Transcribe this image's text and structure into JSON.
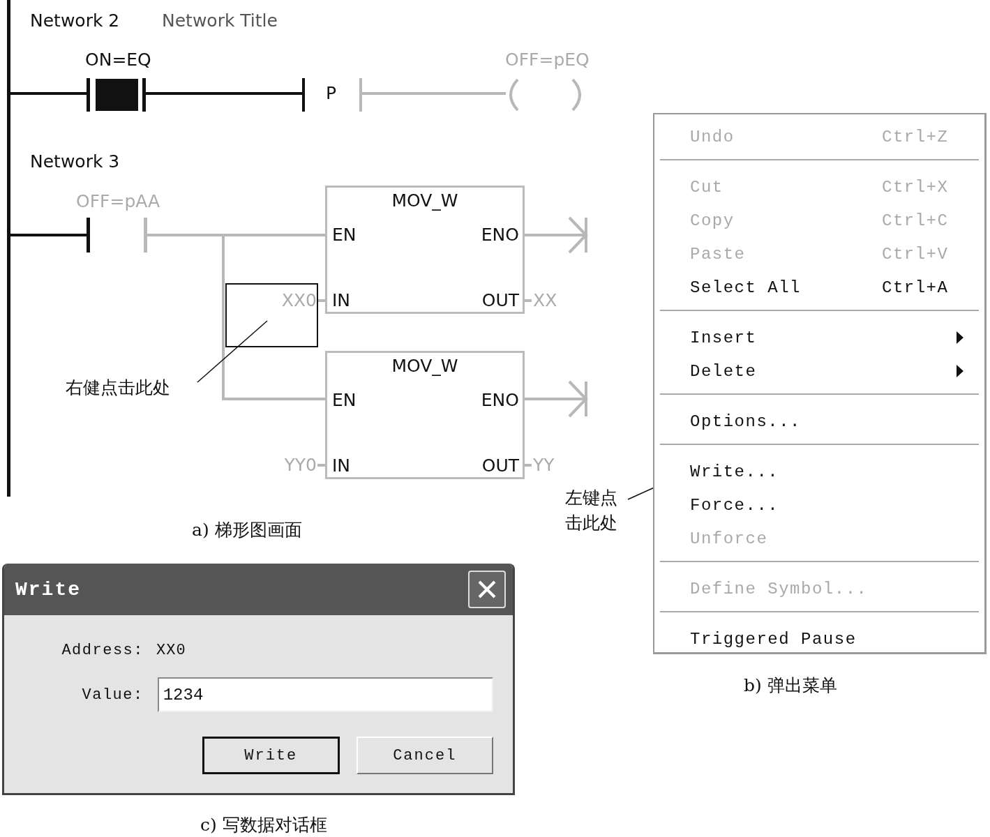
{
  "ladder_diagram": {
    "network_2": {
      "label": "Network 2",
      "title": "Network Title",
      "contact_label": "ON=EQ",
      "contact_on": true,
      "edge_label": "P",
      "coil_label": "OFF=pEQ",
      "coil_on": false
    },
    "network_3": {
      "label": "Network 3",
      "contact_label": "OFF=pAA",
      "contact_on": false,
      "blocks": [
        {
          "name": "MOV_W",
          "en": "EN",
          "eno": "ENO",
          "in": "IN",
          "out": "OUT",
          "in_value": "XX0",
          "out_value": "XX"
        },
        {
          "name": "MOV_W",
          "en": "EN",
          "eno": "ENO",
          "in": "IN",
          "out": "OUT",
          "in_value": "YY0",
          "out_value": "YY"
        }
      ]
    },
    "callout": "右健点击此处",
    "caption": "a) 梯形图画面"
  },
  "popup_menu": {
    "items": [
      {
        "kind": "item",
        "label": "Undo",
        "shortcut": "Ctrl+Z",
        "disabled": true
      },
      {
        "kind": "separator"
      },
      {
        "kind": "item",
        "label": "Cut",
        "shortcut": "Ctrl+X",
        "disabled": true
      },
      {
        "kind": "item",
        "label": "Copy",
        "shortcut": "Ctrl+C",
        "disabled": true
      },
      {
        "kind": "item",
        "label": "Paste",
        "shortcut": "Ctrl+V",
        "disabled": true
      },
      {
        "kind": "item",
        "label": "Select All",
        "shortcut": "Ctrl+A",
        "disabled": false
      },
      {
        "kind": "separator"
      },
      {
        "kind": "submenu",
        "label": "Insert",
        "disabled": false
      },
      {
        "kind": "submenu",
        "label": "Delete",
        "disabled": false
      },
      {
        "kind": "separator"
      },
      {
        "kind": "item",
        "label": "Options...",
        "disabled": false
      },
      {
        "kind": "separator"
      },
      {
        "kind": "item",
        "label": "Write...",
        "disabled": false
      },
      {
        "kind": "item",
        "label": "Force...",
        "disabled": false
      },
      {
        "kind": "item",
        "label": "Unforce",
        "disabled": true
      },
      {
        "kind": "separator"
      },
      {
        "kind": "item",
        "label": "Define Symbol...",
        "disabled": true
      },
      {
        "kind": "separator"
      },
      {
        "kind": "item",
        "label": "Triggered Pause",
        "disabled": false
      }
    ],
    "callout": "左键点击此处",
    "caption": "b) 弹出菜单"
  },
  "write_dialog": {
    "title": "Write",
    "address_label": "Address:",
    "address": "XX0",
    "value_label": "Value:",
    "value": "1234",
    "buttons": [
      {
        "label": "Write",
        "default": true
      },
      {
        "label": "Cancel",
        "default": false
      }
    ],
    "caption": "c) 写数据对话框"
  }
}
